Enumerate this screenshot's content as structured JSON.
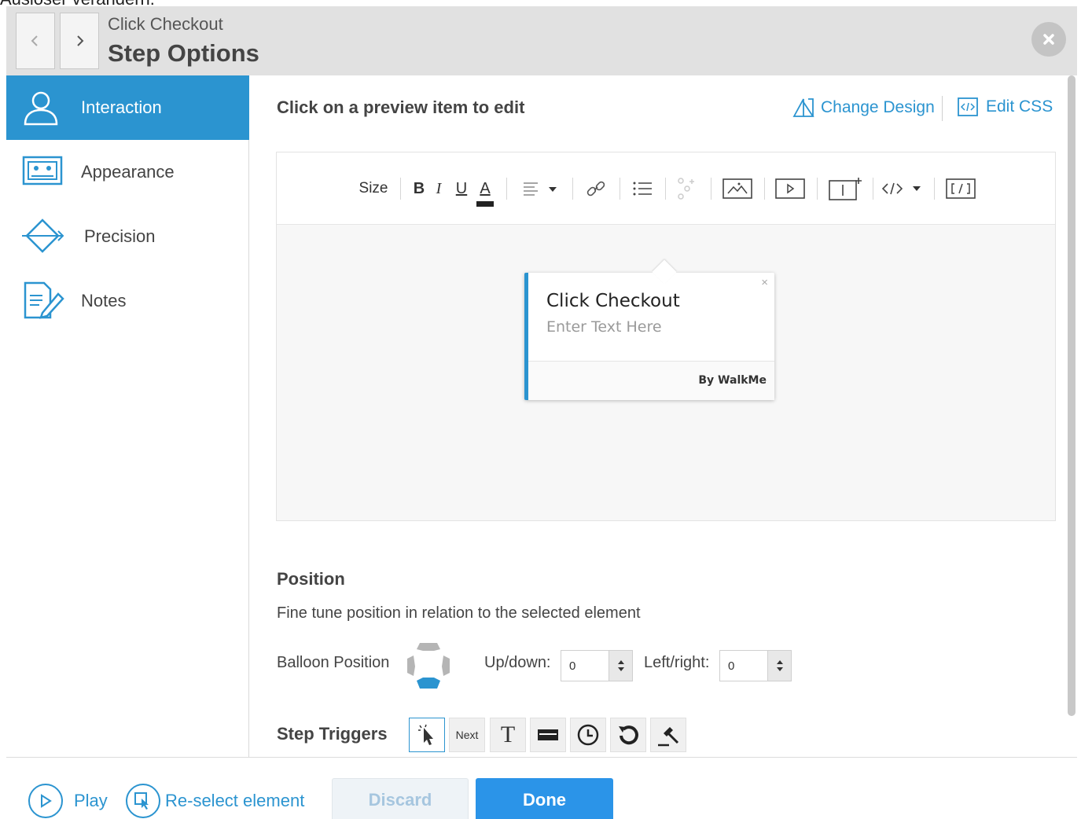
{
  "top_cut_text": "Auslöser verändern.",
  "header": {
    "subtitle": "Click Checkout",
    "title": "Step Options",
    "prev_icon": "chevron-left-icon",
    "next_icon": "chevron-right-icon",
    "close_icon": "close-icon"
  },
  "sidebar": {
    "items": [
      {
        "label": "Interaction",
        "icon": "user-icon",
        "active": true
      },
      {
        "label": "Appearance",
        "icon": "image-icon",
        "active": false
      },
      {
        "label": "Precision",
        "icon": "target-icon",
        "active": false
      },
      {
        "label": "Notes",
        "icon": "notes-icon",
        "active": false
      }
    ]
  },
  "main": {
    "edit_hint": "Click on a preview item to edit",
    "change_design": "Change Design",
    "edit_css": "Edit CSS"
  },
  "toolbar": {
    "size_label": "Size",
    "bold": "B",
    "italic": "I",
    "underline": "U",
    "font_color": "A"
  },
  "balloon": {
    "title": "Click Checkout",
    "text": "Enter Text Here",
    "close": "×",
    "branding": "By WalkMe"
  },
  "position": {
    "title": "Position",
    "description": "Fine tune position in relation to the selected element",
    "balloon_position_label": "Balloon Position",
    "updown_label": "Up/down:",
    "updown_value": "0",
    "leftright_label": "Left/right:",
    "leftright_value": "0"
  },
  "step_triggers": {
    "title": "Step Triggers",
    "next_label": "Next",
    "type_label": "T"
  },
  "footer": {
    "play": "Play",
    "reselect": "Re-select element",
    "discard": "Discard",
    "done": "Done"
  },
  "colors": {
    "accent": "#2b94d0",
    "done_button": "#2b94e8",
    "header_bg": "#e1e1e1"
  }
}
